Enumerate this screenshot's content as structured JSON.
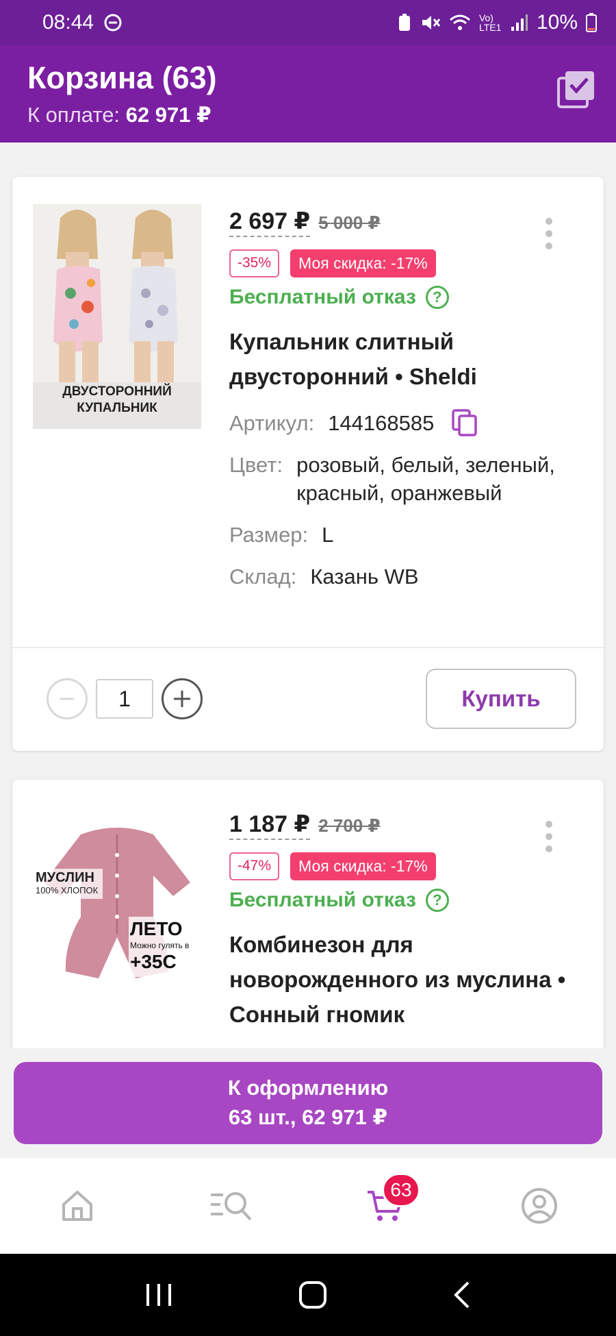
{
  "status_bar": {
    "time": "08:44",
    "battery": "10%",
    "network": "Vo) LTE1"
  },
  "header": {
    "title": "Корзина (63)",
    "subtitle_label": "К оплате:",
    "subtitle_amount": "62 971 ₽"
  },
  "products": [
    {
      "price": "2 697 ₽",
      "old_price": "5 000 ₽",
      "discount": "-35%",
      "my_discount": "Моя скидка: -17%",
      "free_return": "Бесплатный отказ",
      "name": "Купальник слитный двусторонний • Sheldi",
      "image_caption_1": "ДВУСТОРОННИЙ",
      "image_caption_2": "КУПАЛЬНИК",
      "article_label": "Артикул:",
      "article": "144168585",
      "color_label": "Цвет:",
      "color": "розовый, белый, зеленый, красный, оранжевый",
      "size_label": "Размер:",
      "size": "L",
      "warehouse_label": "Склад:",
      "warehouse": "Казань WB",
      "quantity": "1",
      "buy_label": "Купить"
    },
    {
      "price": "1 187 ₽",
      "old_price": "2 700 ₽",
      "discount": "-47%",
      "my_discount": "Моя скидка: -17%",
      "free_return": "Бесплатный отказ",
      "name": "Комбинезон для новорожденного из муслина • Сонный гномик",
      "image_tag_1": "МУСЛИН",
      "image_tag_2": "100% ХЛОПОК",
      "image_tag_3": "ЛЕТО",
      "image_tag_4": "Можно гулять в",
      "image_tag_5": "+35С"
    }
  ],
  "checkout": {
    "label": "К оформлению",
    "summary": "63 шт., 62 971 ₽"
  },
  "bottom_nav": {
    "cart_count": "63",
    "active_color": "#a847c3"
  },
  "colors": {
    "header_bg": "#7b1fa2",
    "status_bg": "#6c1f97",
    "accent": "#a847c3",
    "discount_pink": "#f43f6e",
    "free_return_green": "#4caf50"
  }
}
